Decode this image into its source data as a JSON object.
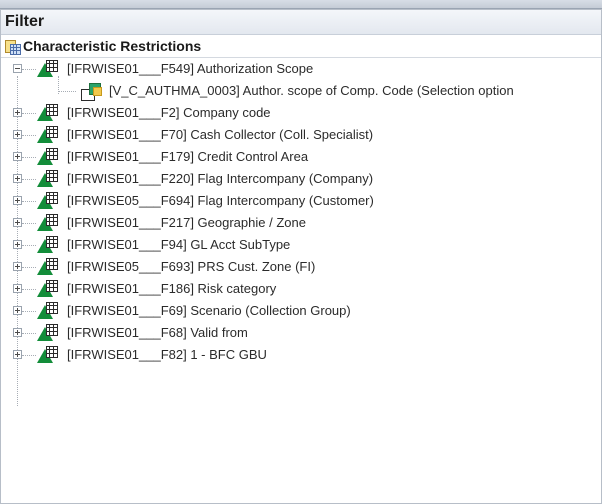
{
  "panel": {
    "title": "Filter",
    "section_label": "Characteristic Restrictions"
  },
  "tree": {
    "root": {
      "label": "[IFRWISE01___F549] Authorization Scope",
      "expanded": true
    },
    "child": {
      "label": "[V_C_AUTHMA_0003] Author. scope of Comp. Code (Selection option"
    },
    "items": [
      {
        "label": "[IFRWISE01___F2] Company code"
      },
      {
        "label": "[IFRWISE01___F70] Cash Collector (Coll. Specialist)"
      },
      {
        "label": "[IFRWISE01___F179] Credit Control Area"
      },
      {
        "label": "[IFRWISE01___F220] Flag Intercompany (Company)"
      },
      {
        "label": "[IFRWISE05___F694] Flag Intercompany (Customer)"
      },
      {
        "label": "[IFRWISE01___F217] Geographie / Zone"
      },
      {
        "label": "[IFRWISE01___F94] GL Acct SubType"
      },
      {
        "label": "[IFRWISE05___F693] PRS Cust. Zone (FI)"
      },
      {
        "label": "[IFRWISE01___F186] Risk category"
      },
      {
        "label": "[IFRWISE01___F69] Scenario (Collection Group)"
      },
      {
        "label": "[IFRWISE01___F68] Valid from"
      },
      {
        "label": "[IFRWISE01___F82] 1 - BFC GBU"
      }
    ]
  }
}
